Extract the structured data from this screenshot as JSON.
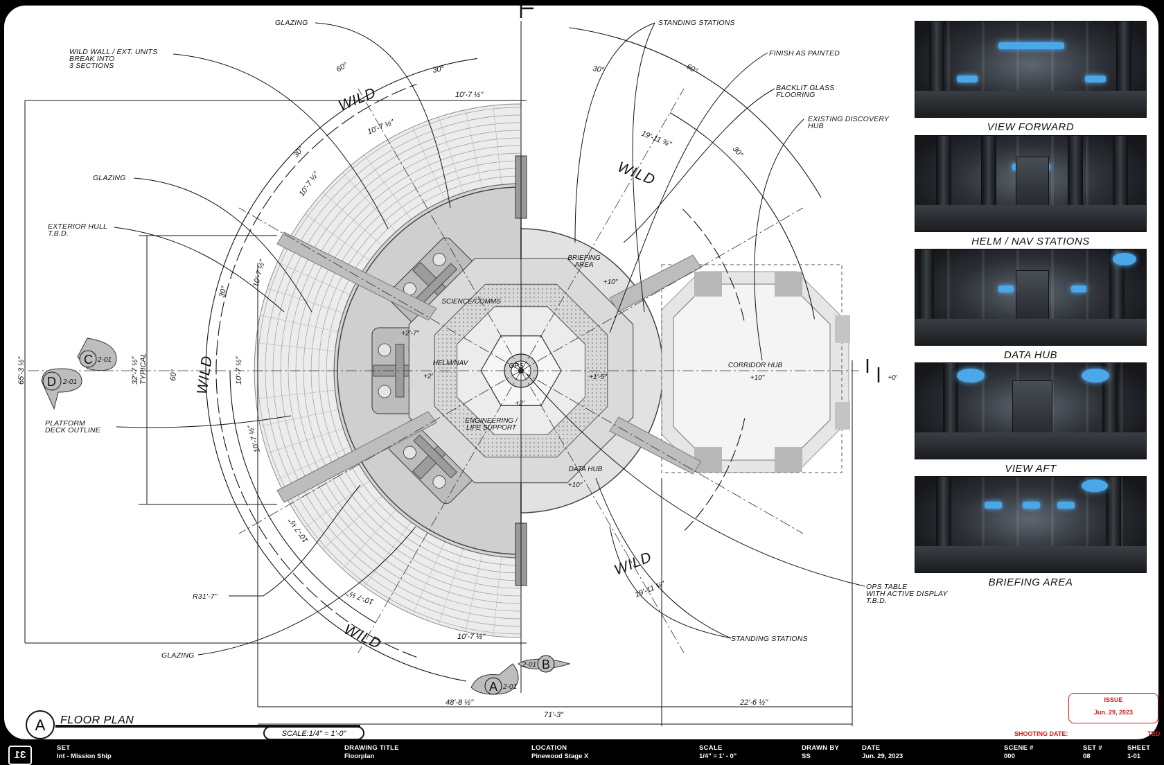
{
  "plan": {
    "callouts": {
      "glazing_top": "GLAZING",
      "wild_wall_1": "WILD WALL / EXT. UNITS",
      "wild_wall_2": "BREAK INTO",
      "wild_wall_3": "3 SECTIONS",
      "glazing_left": "GLAZING",
      "exterior_hull_1": "EXTERIOR HULL",
      "exterior_hull_2": "T.B.D.",
      "platform_deck_1": "PLATFORM",
      "platform_deck_2": "DECK OUTLINE",
      "r31": "R31'-7\"",
      "glazing_bottom": "GLAZING",
      "standing_top": "STANDING STATIONS",
      "finish": "FINISH AS PAINTED",
      "backlit_1": "BACKLIT GLASS",
      "backlit_2": "FLOORING",
      "existing_1": "EXISTING DISCOVERY",
      "existing_2": "HUB",
      "ops_table_1": "OPS TABLE",
      "ops_table_2": "WITH ACTIVE DISPLAY",
      "ops_table_3": "T.B.D.",
      "standing_bottom": "STANDING STATIONS"
    },
    "rooms": {
      "science": "SCIENCE/COMMS",
      "helm": "HELM/NAV",
      "engineering_1": "ENGINEERING /",
      "engineering_2": "LIFE SUPPORT",
      "ops": "OPS",
      "briefing_1": "BRIEFING",
      "briefing_2": "AREA",
      "data_hub": "DATA HUB",
      "corridor_hub": "CORRIDOR HUB"
    },
    "elevations": {
      "briefing": "+10\"",
      "data_hub": "+10\"",
      "corridor": "+10\"",
      "science": "+2'-7\"",
      "helm": "+2'",
      "ops": "+2'",
      "ops_right": "+1'-5\"",
      "datum": "+0'"
    },
    "dimensions": {
      "d_top_arc": "10'-7 ½\"",
      "d_a1": "10'-7 ½\"",
      "d_a2": "10'-7 ½\"",
      "d_a3": "10'-7 ½\"",
      "d_center": "10'-7 ½\"",
      "d_a5": "10'-7 ½\"",
      "d_a6": "10'-7 ½\"",
      "d_a7": "10'-7 ½\"",
      "d_bottom_arc": "10'-7 ½\"",
      "d_right_top": "19'-11 ¾\"",
      "d_right_bottom": "19'-11 ¾\"",
      "overall_height": "65'-3 ½\"",
      "typical_1": "32'-7 ½\"",
      "typical_2": "TYPICAL",
      "bottom_left": "48'-8 ½\"",
      "bottom_total": "71'-3\"",
      "bottom_right": "22'-6 ½\""
    },
    "angles": {
      "a60_tl": "60°",
      "a30_tl": "30°",
      "a30_tr": "30°",
      "a60_tr": "60°",
      "a30_r": "30°",
      "a30_l1": "30°",
      "a30_l2": "30°",
      "a60_l": "60°"
    },
    "wild": {
      "top": "WILD",
      "left": "WILD",
      "bottom": "WILD",
      "right_top": "WILD",
      "right_bottom": "WILD"
    },
    "refs": {
      "c_letter": "C",
      "c_sheet": "2-01",
      "d_letter": "D",
      "d_sheet": "2-01",
      "b_letter": "B",
      "b_sheet": "2-01",
      "a_letter": "A",
      "a_sheet": "2-01"
    },
    "title": {
      "letter": "A",
      "name": "FLOOR PLAN",
      "scale": "SCALE:1/4\" = 1'-0\""
    }
  },
  "views": [
    {
      "caption": "VIEW FORWARD"
    },
    {
      "caption": "HELM / NAV STATIONS"
    },
    {
      "caption": "DATA HUB"
    },
    {
      "caption": "VIEW AFT"
    },
    {
      "caption": "BRIEFING AREA"
    }
  ],
  "issue": {
    "label": "ISSUE",
    "date": "Jun. 29, 2023"
  },
  "shooting": {
    "label": "SHOOTING DATE:",
    "value": "TBD"
  },
  "titlebar": {
    "logo": "31",
    "set_label": "SET",
    "set_value": "Int - Mission Ship",
    "drawing_label": "DRAWING TITLE",
    "drawing_value": "Floorplan",
    "location_label": "LOCATION",
    "location_value": "Pinewood Stage X",
    "scale_label": "SCALE",
    "scale_value": "1/4\" = 1' - 0\"",
    "drawn_label": "DRAWN BY",
    "drawn_value": "SS",
    "date_label": "DATE",
    "date_value": "Jun. 29, 2023",
    "scene_label": "SCENE #",
    "scene_value": "000",
    "setnum_label": "SET #",
    "setnum_value": "08",
    "sheet_label": "SHEET",
    "sheet_value": "1-01"
  },
  "colors": {
    "accent_red": "#d21b1b",
    "ink": "#111111",
    "display_glow": "#4aa8e8"
  }
}
